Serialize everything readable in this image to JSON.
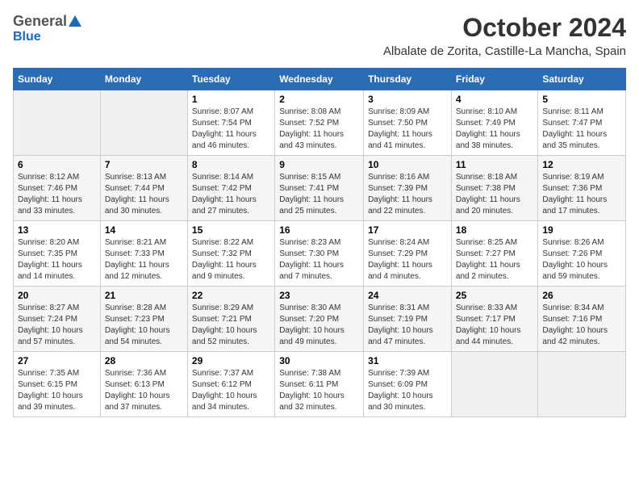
{
  "header": {
    "logo_general": "General",
    "logo_blue": "Blue",
    "month_title": "October 2024",
    "location": "Albalate de Zorita, Castille-La Mancha, Spain"
  },
  "days_of_week": [
    "Sunday",
    "Monday",
    "Tuesday",
    "Wednesday",
    "Thursday",
    "Friday",
    "Saturday"
  ],
  "weeks": [
    [
      {
        "day": "",
        "info": ""
      },
      {
        "day": "",
        "info": ""
      },
      {
        "day": "1",
        "info": "Sunrise: 8:07 AM\nSunset: 7:54 PM\nDaylight: 11 hours and 46 minutes."
      },
      {
        "day": "2",
        "info": "Sunrise: 8:08 AM\nSunset: 7:52 PM\nDaylight: 11 hours and 43 minutes."
      },
      {
        "day": "3",
        "info": "Sunrise: 8:09 AM\nSunset: 7:50 PM\nDaylight: 11 hours and 41 minutes."
      },
      {
        "day": "4",
        "info": "Sunrise: 8:10 AM\nSunset: 7:49 PM\nDaylight: 11 hours and 38 minutes."
      },
      {
        "day": "5",
        "info": "Sunrise: 8:11 AM\nSunset: 7:47 PM\nDaylight: 11 hours and 35 minutes."
      }
    ],
    [
      {
        "day": "6",
        "info": "Sunrise: 8:12 AM\nSunset: 7:46 PM\nDaylight: 11 hours and 33 minutes."
      },
      {
        "day": "7",
        "info": "Sunrise: 8:13 AM\nSunset: 7:44 PM\nDaylight: 11 hours and 30 minutes."
      },
      {
        "day": "8",
        "info": "Sunrise: 8:14 AM\nSunset: 7:42 PM\nDaylight: 11 hours and 27 minutes."
      },
      {
        "day": "9",
        "info": "Sunrise: 8:15 AM\nSunset: 7:41 PM\nDaylight: 11 hours and 25 minutes."
      },
      {
        "day": "10",
        "info": "Sunrise: 8:16 AM\nSunset: 7:39 PM\nDaylight: 11 hours and 22 minutes."
      },
      {
        "day": "11",
        "info": "Sunrise: 8:18 AM\nSunset: 7:38 PM\nDaylight: 11 hours and 20 minutes."
      },
      {
        "day": "12",
        "info": "Sunrise: 8:19 AM\nSunset: 7:36 PM\nDaylight: 11 hours and 17 minutes."
      }
    ],
    [
      {
        "day": "13",
        "info": "Sunrise: 8:20 AM\nSunset: 7:35 PM\nDaylight: 11 hours and 14 minutes."
      },
      {
        "day": "14",
        "info": "Sunrise: 8:21 AM\nSunset: 7:33 PM\nDaylight: 11 hours and 12 minutes."
      },
      {
        "day": "15",
        "info": "Sunrise: 8:22 AM\nSunset: 7:32 PM\nDaylight: 11 hours and 9 minutes."
      },
      {
        "day": "16",
        "info": "Sunrise: 8:23 AM\nSunset: 7:30 PM\nDaylight: 11 hours and 7 minutes."
      },
      {
        "day": "17",
        "info": "Sunrise: 8:24 AM\nSunset: 7:29 PM\nDaylight: 11 hours and 4 minutes."
      },
      {
        "day": "18",
        "info": "Sunrise: 8:25 AM\nSunset: 7:27 PM\nDaylight: 11 hours and 2 minutes."
      },
      {
        "day": "19",
        "info": "Sunrise: 8:26 AM\nSunset: 7:26 PM\nDaylight: 10 hours and 59 minutes."
      }
    ],
    [
      {
        "day": "20",
        "info": "Sunrise: 8:27 AM\nSunset: 7:24 PM\nDaylight: 10 hours and 57 minutes."
      },
      {
        "day": "21",
        "info": "Sunrise: 8:28 AM\nSunset: 7:23 PM\nDaylight: 10 hours and 54 minutes."
      },
      {
        "day": "22",
        "info": "Sunrise: 8:29 AM\nSunset: 7:21 PM\nDaylight: 10 hours and 52 minutes."
      },
      {
        "day": "23",
        "info": "Sunrise: 8:30 AM\nSunset: 7:20 PM\nDaylight: 10 hours and 49 minutes."
      },
      {
        "day": "24",
        "info": "Sunrise: 8:31 AM\nSunset: 7:19 PM\nDaylight: 10 hours and 47 minutes."
      },
      {
        "day": "25",
        "info": "Sunrise: 8:33 AM\nSunset: 7:17 PM\nDaylight: 10 hours and 44 minutes."
      },
      {
        "day": "26",
        "info": "Sunrise: 8:34 AM\nSunset: 7:16 PM\nDaylight: 10 hours and 42 minutes."
      }
    ],
    [
      {
        "day": "27",
        "info": "Sunrise: 7:35 AM\nSunset: 6:15 PM\nDaylight: 10 hours and 39 minutes."
      },
      {
        "day": "28",
        "info": "Sunrise: 7:36 AM\nSunset: 6:13 PM\nDaylight: 10 hours and 37 minutes."
      },
      {
        "day": "29",
        "info": "Sunrise: 7:37 AM\nSunset: 6:12 PM\nDaylight: 10 hours and 34 minutes."
      },
      {
        "day": "30",
        "info": "Sunrise: 7:38 AM\nSunset: 6:11 PM\nDaylight: 10 hours and 32 minutes."
      },
      {
        "day": "31",
        "info": "Sunrise: 7:39 AM\nSunset: 6:09 PM\nDaylight: 10 hours and 30 minutes."
      },
      {
        "day": "",
        "info": ""
      },
      {
        "day": "",
        "info": ""
      }
    ]
  ]
}
